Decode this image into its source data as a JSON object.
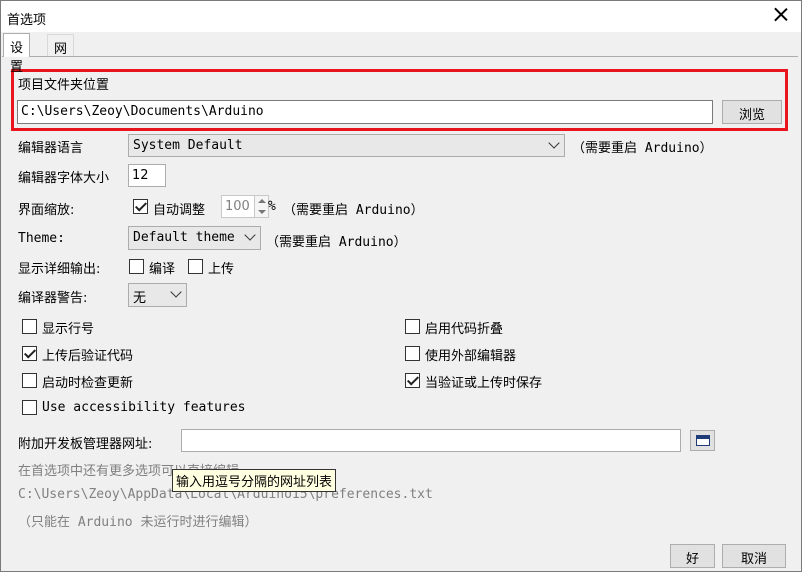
{
  "window": {
    "title": "首选项"
  },
  "tabs": [
    {
      "label": "设置",
      "active": true
    },
    {
      "label": "网络",
      "active": false
    }
  ],
  "sketchbook": {
    "label": "项目文件夹位置",
    "path": "C:\\Users\\Zeoy\\Documents\\Arduino",
    "browse_label": "浏览"
  },
  "editor_language": {
    "label": "编辑器语言",
    "value": "System Default",
    "note": "（需要重启 Arduino）"
  },
  "editor_font_size": {
    "label": "编辑器字体大小",
    "value": "12"
  },
  "interface_scale": {
    "label": "界面缩放:",
    "auto_label": "自动调整",
    "auto_checked": true,
    "value": "100",
    "unit": "%",
    "note": "（需要重启 Arduino）"
  },
  "theme": {
    "label": "Theme:",
    "value": "Default theme",
    "note": "（需要重启 Arduino）"
  },
  "verbose_output": {
    "label": "显示详细输出:",
    "compile_label": "编译",
    "compile_checked": false,
    "upload_label": "上传",
    "upload_checked": false
  },
  "compiler_warnings": {
    "label": "编译器警告:",
    "value": "无"
  },
  "options_left": [
    {
      "label": "显示行号",
      "checked": false
    },
    {
      "label": "上传后验证代码",
      "checked": true
    },
    {
      "label": "启动时检查更新",
      "checked": false
    },
    {
      "label": "Use accessibility features",
      "checked": false
    }
  ],
  "options_right": [
    {
      "label": "启用代码折叠",
      "checked": false
    },
    {
      "label": "使用外部编辑器",
      "checked": false
    },
    {
      "label": "当验证或上传时保存",
      "checked": true
    }
  ],
  "board_manager": {
    "label": "附加开发板管理器网址:",
    "value": "",
    "tooltip": "输入用逗号分隔的网址列表"
  },
  "info": {
    "more_prefs": "在首选项中还有更多选项可以直接编辑",
    "prefs_path": "C:\\Users\\Zeoy\\AppData\\Local\\Arduino15\\preferences.txt",
    "edit_note": "（只能在 Arduino 未运行时进行编辑）"
  },
  "buttons": {
    "ok": "好",
    "cancel": "取消"
  },
  "colors": {
    "highlight": "#e8141e"
  }
}
